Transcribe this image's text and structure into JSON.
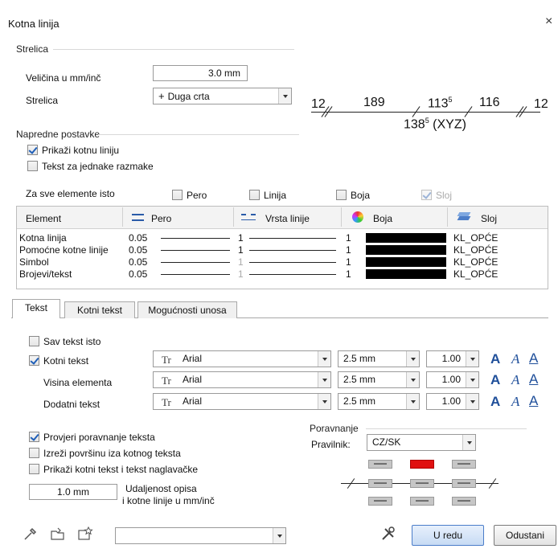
{
  "window": {
    "title": "Kotna linija",
    "close_glyph": "×"
  },
  "strelica": {
    "group": "Strelica",
    "size_label": "Veličina u mm/inč",
    "size_value": "3.0 mm",
    "arrow_label": "Strelica",
    "arrow_value": "Duga crta"
  },
  "preview": {
    "left_end": "12",
    "v1": "189",
    "v2": "113",
    "v2_sup": "5",
    "v3": "116",
    "right_end": "12",
    "total": "138",
    "total_sup": "5",
    "total_suffix": "(XYZ)"
  },
  "napredne": {
    "group": "Napredne postavke",
    "show_line": "Prikaži kotnu liniju",
    "show_line_checked": true,
    "equal_text": "Tekst za jednake razmake",
    "equal_text_checked": false
  },
  "same_all": {
    "label": "Za sve elemente isto",
    "pero": "Pero",
    "linija": "Linija",
    "boja": "Boja",
    "sloj": "Sloj"
  },
  "table": {
    "headers": {
      "element": "Element",
      "pero": "Pero",
      "vrsta": "Vrsta linije",
      "boja": "Boja",
      "sloj": "Sloj"
    },
    "rows": [
      {
        "element": "Kotna linija",
        "pero": "0.05",
        "linetype": "1",
        "color": "1",
        "layer": "KL_OPĆE"
      },
      {
        "element": "Pomoćne kotne linije",
        "pero": "0.05",
        "linetype": "1",
        "color": "1",
        "layer": "KL_OPĆE"
      },
      {
        "element": "Simbol",
        "pero": "0.05",
        "linetype": "1",
        "color": "1",
        "layer": "KL_OPĆE"
      },
      {
        "element": "Brojevi/tekst",
        "pero": "0.05",
        "linetype": "1",
        "color": "1",
        "layer": "KL_OPĆE"
      }
    ]
  },
  "tabs": {
    "t1": "Tekst",
    "t2": "Kotni tekst",
    "t3": "Mogućnosti unosa"
  },
  "text": {
    "same_all": "Sav tekst isto",
    "rows": [
      {
        "label": "Kotni tekst",
        "font": "Arial",
        "size": "2.5 mm",
        "factor": "1.00"
      },
      {
        "label": "Visina elementa",
        "font": "Arial",
        "size": "2.5 mm",
        "factor": "1.00"
      },
      {
        "label": "Dodatni tekst",
        "font": "Arial",
        "size": "2.5 mm",
        "factor": "1.00"
      }
    ],
    "tt_glyph": "Tr",
    "fmt_a": "A"
  },
  "options": {
    "check_align": "Provjeri poravnanje teksta",
    "cut_area": "Izreži površinu iza kotnog teksta",
    "caps": "Prikaži kotni tekst i tekst naglavačke",
    "dist_value": "1.0 mm",
    "dist_label1": "Udaljenost opisa",
    "dist_label2": "i kotne linije u mm/inč"
  },
  "align": {
    "group": "Poravnanje",
    "rule_label": "Pravilnik:",
    "rule_value": "CZ/SK"
  },
  "buttons": {
    "ok": "U redu",
    "cancel": "Odustani"
  },
  "colors": {
    "accent": "#1f5fb8",
    "red": "#e01010"
  }
}
